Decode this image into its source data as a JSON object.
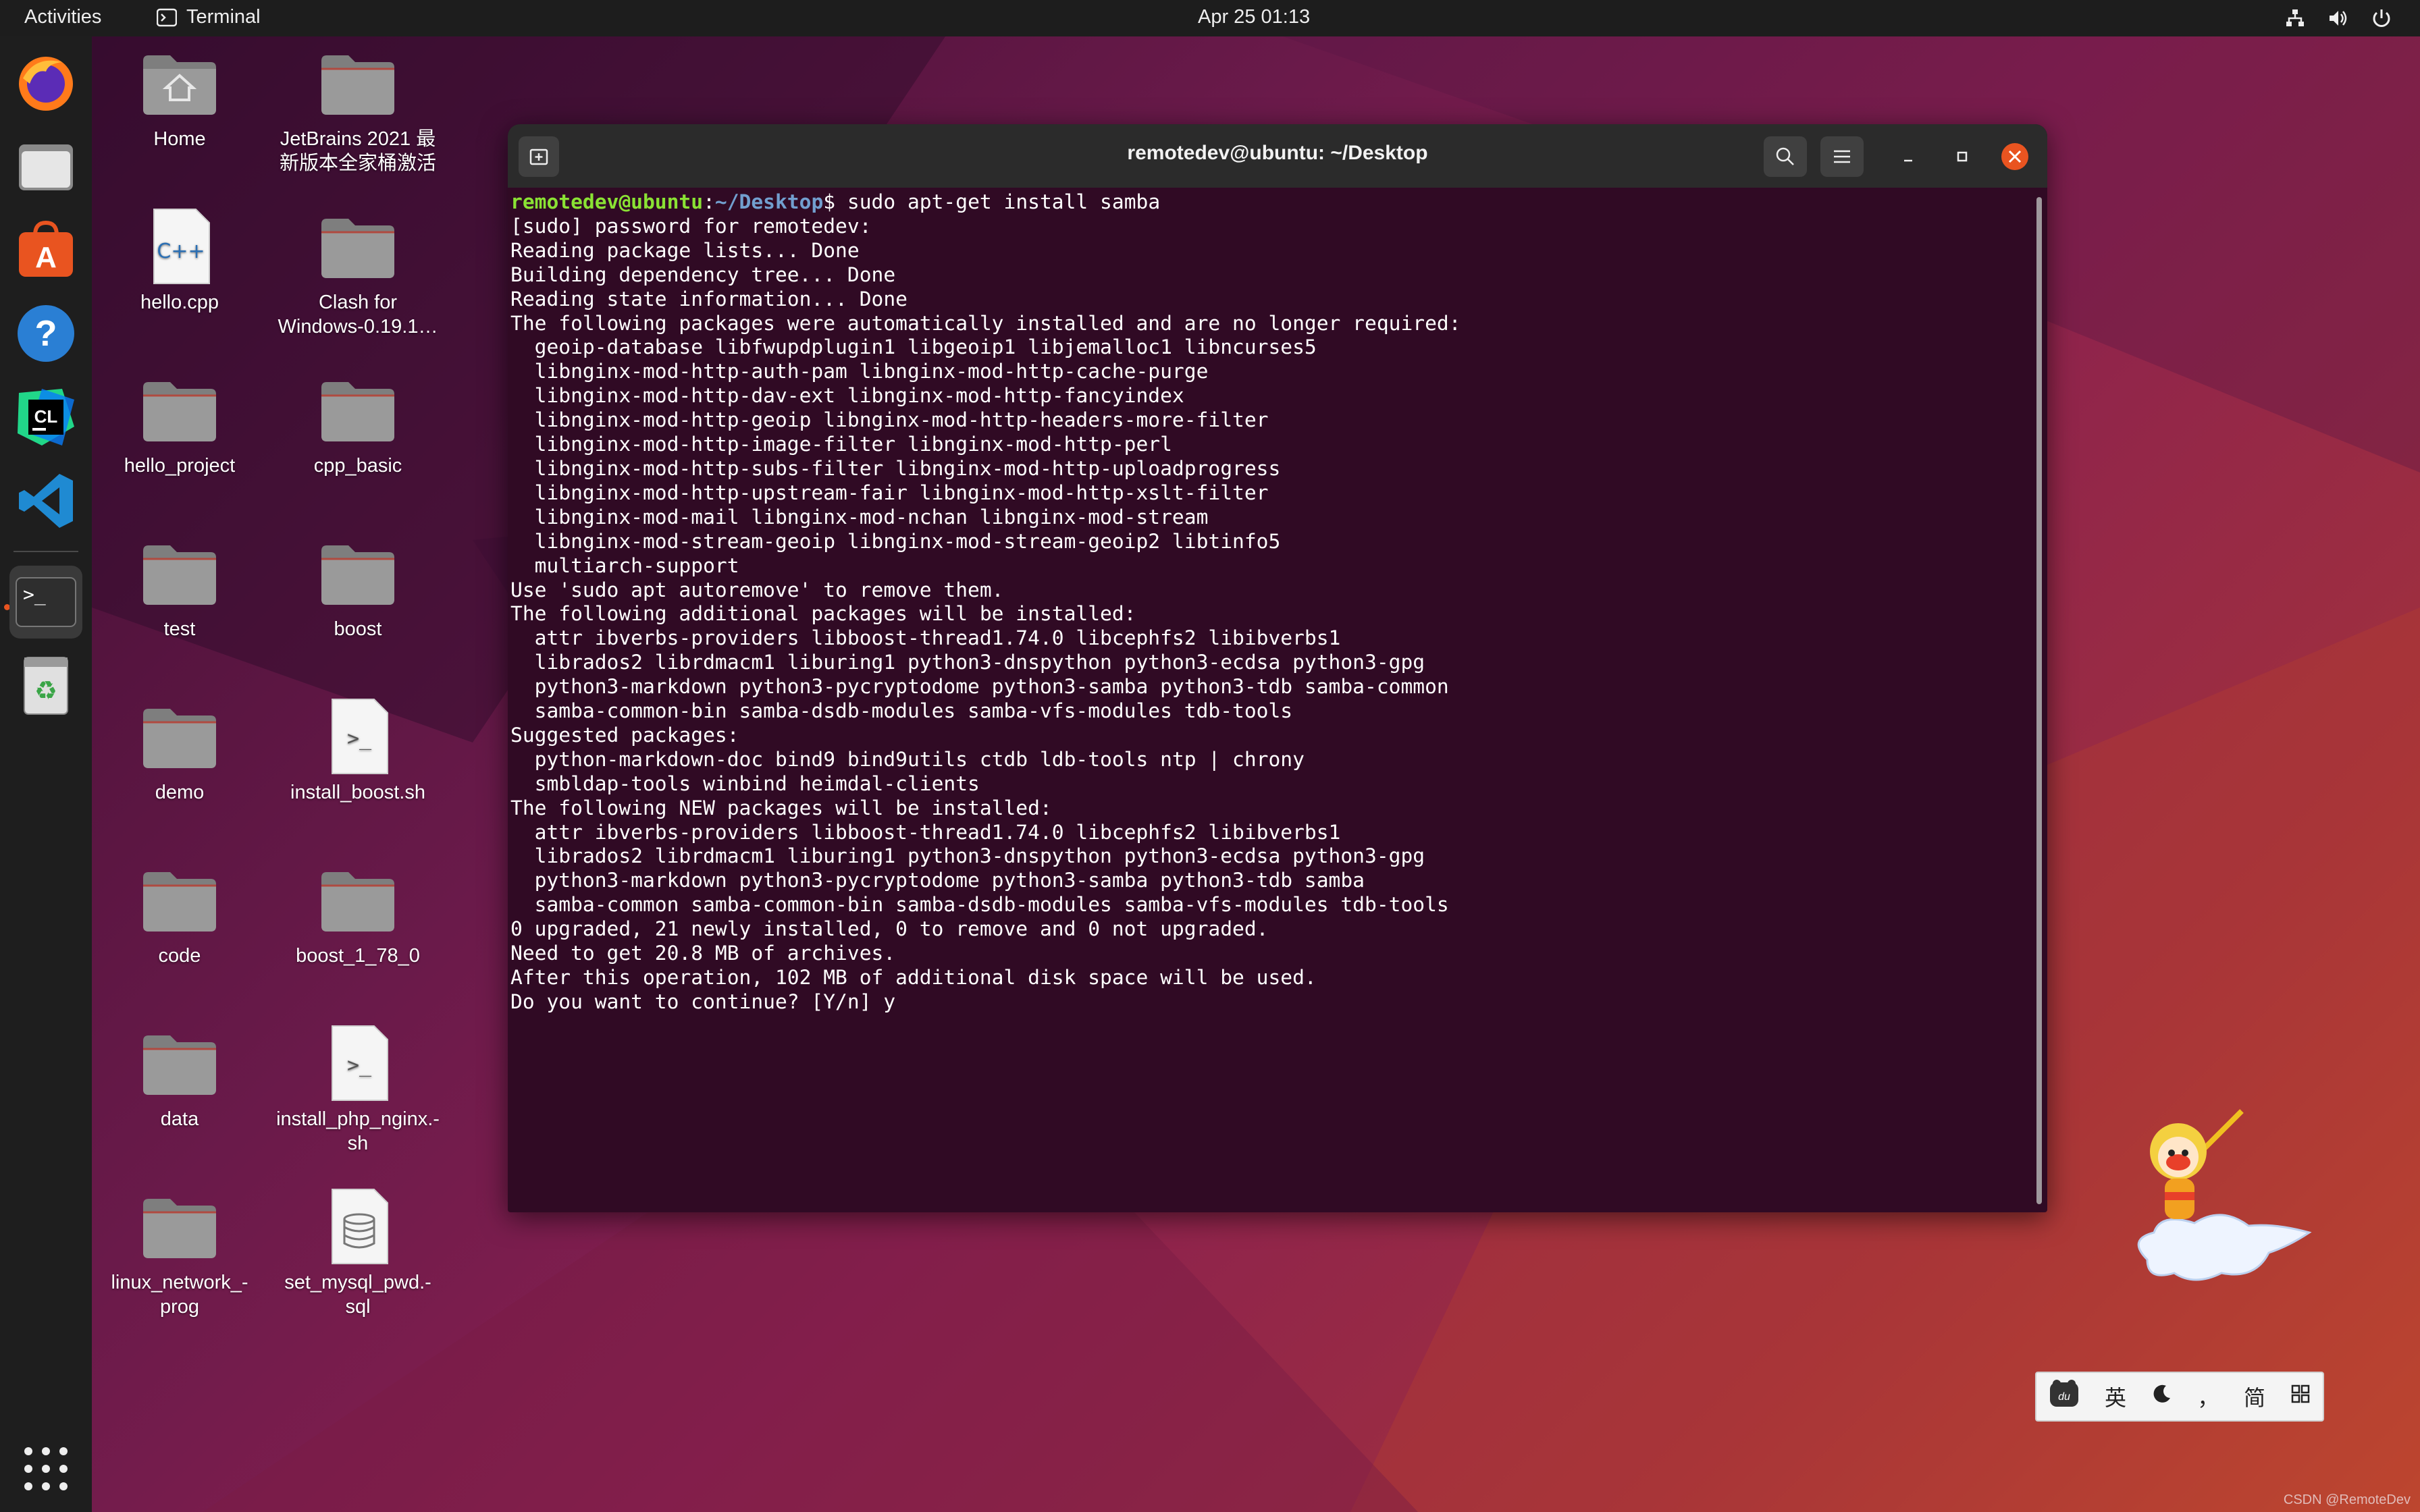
{
  "topbar": {
    "activities": "Activities",
    "app_name": "Terminal",
    "clock": "Apr 25  01:13"
  },
  "dock": {
    "items": [
      "firefox-icon",
      "files-icon",
      "software-icon",
      "help-icon",
      "clion-icon",
      "vscode-icon",
      "terminal-icon",
      "trash-icon"
    ],
    "active": "terminal-icon"
  },
  "desktop": {
    "icons": [
      {
        "label": "Home",
        "type": "home"
      },
      {
        "label": "JetBrains 2021 最新版本全家桶激活",
        "type": "folder"
      },
      {
        "label": "hello.cpp",
        "type": "cpp"
      },
      {
        "label": "Clash for Windows-0.19.1…",
        "type": "folder"
      },
      {
        "label": "hello_project",
        "type": "folder"
      },
      {
        "label": "cpp_basic",
        "type": "folder"
      },
      {
        "label": "test",
        "type": "folder"
      },
      {
        "label": "boost",
        "type": "folder"
      },
      {
        "label": "demo",
        "type": "folder"
      },
      {
        "label": "install_boost.sh",
        "type": "script"
      },
      {
        "label": "code",
        "type": "folder"
      },
      {
        "label": "boost_1_78_0",
        "type": "folder"
      },
      {
        "label": "data",
        "type": "folder"
      },
      {
        "label": "install_php_nginx.-sh",
        "type": "script"
      },
      {
        "label": "linux_network_-prog",
        "type": "folder"
      },
      {
        "label": "set_mysql_pwd.-sql",
        "type": "database"
      }
    ]
  },
  "terminal": {
    "title": "remotedev@ubuntu: ~/Desktop",
    "prompt_user": "remotedev@ubuntu",
    "prompt_path": "~/Desktop",
    "command": "$ sudo apt-get install samba",
    "lines": [
      "[sudo] password for remotedev:",
      "Reading package lists... Done",
      "Building dependency tree... Done",
      "Reading state information... Done",
      "The following packages were automatically installed and are no longer required:",
      "  geoip-database libfwupdplugin1 libgeoip1 libjemalloc1 libncurses5",
      "  libnginx-mod-http-auth-pam libnginx-mod-http-cache-purge",
      "  libnginx-mod-http-dav-ext libnginx-mod-http-fancyindex",
      "  libnginx-mod-http-geoip libnginx-mod-http-headers-more-filter",
      "  libnginx-mod-http-image-filter libnginx-mod-http-perl",
      "  libnginx-mod-http-subs-filter libnginx-mod-http-uploadprogress",
      "  libnginx-mod-http-upstream-fair libnginx-mod-http-xslt-filter",
      "  libnginx-mod-mail libnginx-mod-nchan libnginx-mod-stream",
      "  libnginx-mod-stream-geoip libnginx-mod-stream-geoip2 libtinfo5",
      "  multiarch-support",
      "Use 'sudo apt autoremove' to remove them.",
      "The following additional packages will be installed:",
      "  attr ibverbs-providers libboost-thread1.74.0 libcephfs2 libibverbs1",
      "  librados2 librdmacm1 liburing1 python3-dnspython python3-ecdsa python3-gpg",
      "  python3-markdown python3-pycryptodome python3-samba python3-tdb samba-common",
      "  samba-common-bin samba-dsdb-modules samba-vfs-modules tdb-tools",
      "Suggested packages:",
      "  python-markdown-doc bind9 bind9utils ctdb ldb-tools ntp | chrony",
      "  smbldap-tools winbind heimdal-clients",
      "The following NEW packages will be installed:",
      "  attr ibverbs-providers libboost-thread1.74.0 libcephfs2 libibverbs1",
      "  librados2 librdmacm1 liburing1 python3-dnspython python3-ecdsa python3-gpg",
      "  python3-markdown python3-pycryptodome python3-samba python3-tdb samba",
      "  samba-common samba-common-bin samba-dsdb-modules samba-vfs-modules tdb-tools",
      "0 upgraded, 21 newly installed, 0 to remove and 0 not upgraded.",
      "Need to get 20.8 MB of archives.",
      "After this operation, 102 MB of additional disk space will be used.",
      "Do you want to continue? [Y/n] y"
    ]
  },
  "ime": {
    "lang": "英",
    "simplified": "简",
    "punct": "，"
  },
  "watermark": "CSDN @RemoteDev",
  "colors": {
    "terminal_bg": "#300a24",
    "prompt_user": "#8ae234",
    "prompt_path": "#729fcf",
    "accent": "#e95420"
  }
}
